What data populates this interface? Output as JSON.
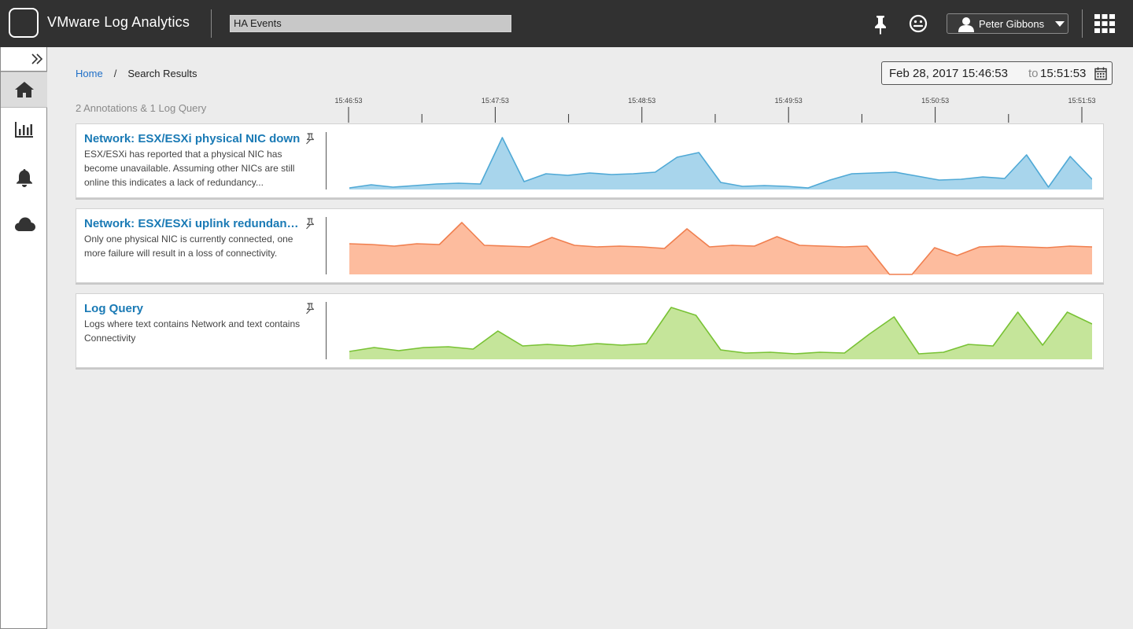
{
  "header": {
    "app_title": "VMware Log Analytics",
    "search_value": "HA Events",
    "user_name": "Peter Gibbons",
    "icons": [
      "logo-icon",
      "pin-icon",
      "smiley-icon",
      "user-icon",
      "caret-down-icon",
      "apps-grid-icon"
    ]
  },
  "sidebar": {
    "items": [
      {
        "name": "home",
        "icon": "home-icon",
        "active": true
      },
      {
        "name": "dashboards",
        "icon": "bar-chart-icon",
        "active": false
      },
      {
        "name": "alerts",
        "icon": "bell-icon",
        "active": false
      },
      {
        "name": "cloud",
        "icon": "cloud-icon",
        "active": false
      }
    ]
  },
  "breadcrumb": {
    "home": "Home",
    "separator": "/",
    "current": "Search Results"
  },
  "date_range": {
    "from": "Feb 28, 2017 15:46:53",
    "to_label": "to",
    "to": "15:51:53"
  },
  "summary": "2 Annotations & 1 Log Query",
  "timeline": {
    "labels": [
      "15:46:53",
      "15:47:53",
      "15:48:53",
      "15:49:53",
      "15:50:53",
      "15:51:53"
    ]
  },
  "colors": {
    "blue_stroke": "#4fa9d6",
    "blue_fill": "#a8d5ec",
    "orange_stroke": "#f07f4f",
    "orange_fill": "#fdbc9e",
    "green_stroke": "#78c234",
    "green_fill": "#c5e59a",
    "title_blue": "#1a7ab5"
  },
  "cards": [
    {
      "title": "Network: ESX/ESXi physical NIC down",
      "description": "ESX/ESXi has reported that a physical NIC has become unavailable. Assuming other NICs are still online this indicates a lack of redundancy...",
      "color_key": "blue"
    },
    {
      "title": "Network: ESX/ESXi uplink redundancy...",
      "description": "Only one physical NIC is currently connected, one more failure will result in a loss of connectivity.",
      "color_key": "orange"
    },
    {
      "title": "Log Query",
      "description": "Logs where text contains Network and text contains Connectivity",
      "color_key": "green"
    }
  ],
  "chart_data": [
    {
      "type": "area",
      "series": [
        {
          "values": [
            2,
            6,
            3,
            5,
            7,
            8,
            7,
            66,
            10,
            20,
            18,
            21,
            19,
            20,
            22,
            41,
            47,
            9,
            4,
            5,
            4,
            2,
            12,
            20,
            21,
            22,
            17,
            12,
            13,
            16,
            14,
            44,
            3,
            42,
            13
          ]
        }
      ],
      "x_range": [
        "15:46:53",
        "15:51:53"
      ],
      "ylim": [
        0,
        70
      ]
    },
    {
      "type": "area",
      "series": [
        {
          "values": [
            39,
            38,
            36,
            39,
            38,
            66,
            37,
            36,
            35,
            47,
            37,
            35,
            36,
            35,
            33,
            58,
            35,
            37,
            36,
            48,
            37,
            36,
            35,
            36,
            0,
            0,
            34,
            24,
            35,
            36,
            35,
            34,
            36,
            35
          ]
        }
      ],
      "x_range": [
        "15:46:53",
        "15:51:53"
      ],
      "ylim": [
        0,
        70
      ]
    },
    {
      "type": "area",
      "series": [
        {
          "values": [
            10,
            15,
            11,
            15,
            16,
            13,
            36,
            17,
            19,
            17,
            20,
            18,
            20,
            66,
            56,
            12,
            8,
            9,
            7,
            9,
            8,
            32,
            54,
            7,
            9,
            19,
            17,
            60,
            18,
            60,
            45
          ]
        }
      ],
      "x_range": [
        "15:46:53",
        "15:51:53"
      ],
      "ylim": [
        0,
        70
      ]
    }
  ]
}
